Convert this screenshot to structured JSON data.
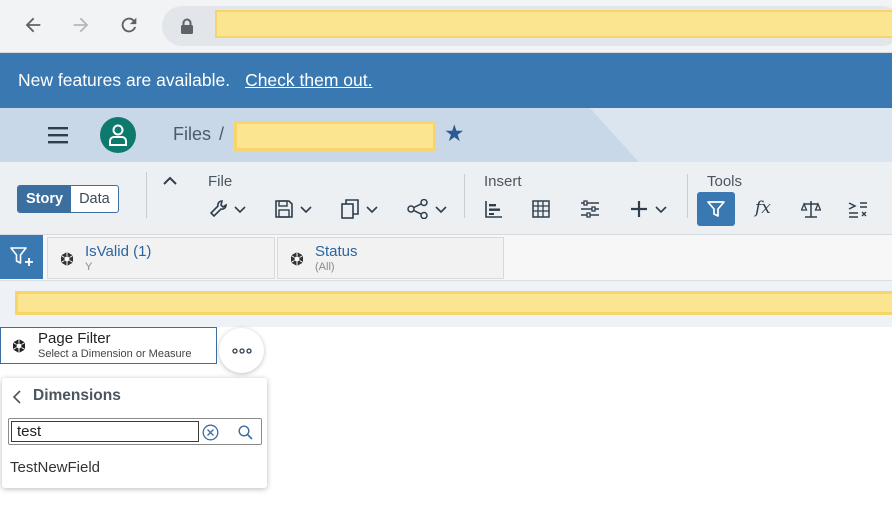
{
  "browser": {
    "back_icon": "arrow-left-icon",
    "forward_icon": "arrow-right-icon",
    "reload_icon": "reload-icon",
    "lock_icon": "lock-icon"
  },
  "banner": {
    "message": "New features are available.",
    "link": "Check them out."
  },
  "shell": {
    "files_label": "Files",
    "separator": "/",
    "favorite_icon": "star-icon"
  },
  "toolbar": {
    "tabs": [
      "Story",
      "Data"
    ],
    "active_tab": "Story",
    "groups": {
      "file": "File",
      "insert": "Insert",
      "tools": "Tools"
    }
  },
  "filter_bar": {
    "filters": [
      {
        "name": "IsValid (1)",
        "value": "Y"
      },
      {
        "name": "Status",
        "value": "(All)"
      }
    ]
  },
  "page_filter": {
    "title": "Page Filter",
    "subtitle": "Select a Dimension or Measure"
  },
  "popover": {
    "title": "Dimensions",
    "search_value": "test",
    "results": [
      "TestNewField"
    ]
  },
  "colors": {
    "accent": "#3a78b2",
    "shell": "#c8d8e8",
    "redaction": "#fbe590"
  }
}
